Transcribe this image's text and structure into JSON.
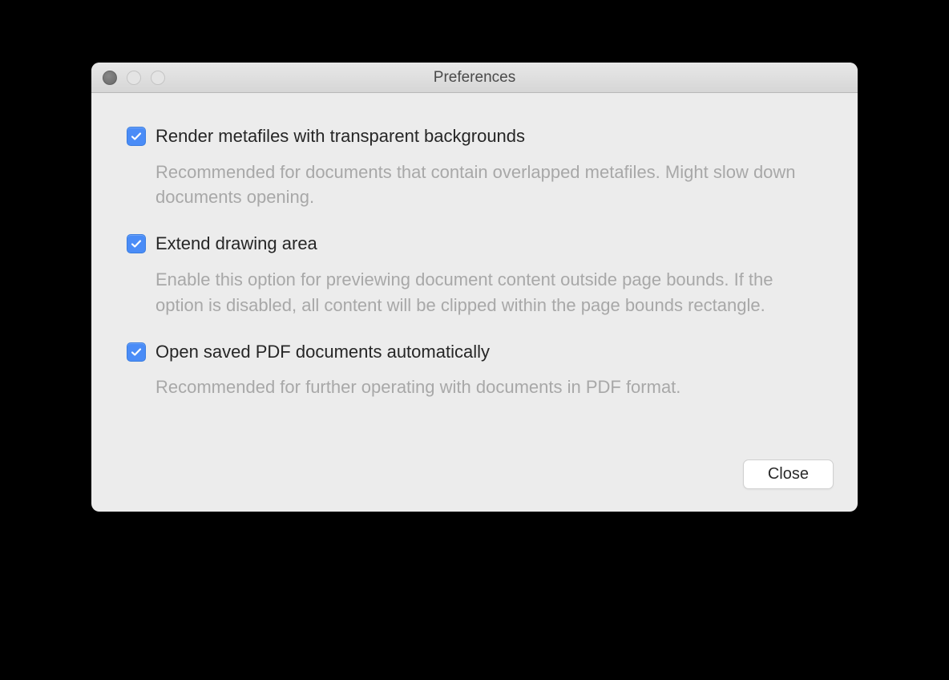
{
  "window": {
    "title": "Preferences"
  },
  "options": [
    {
      "label": "Render metafiles with transparent backgrounds",
      "description": "Recommended for documents that contain overlapped metafiles. Might slow down documents opening.",
      "checked": true
    },
    {
      "label": "Extend drawing area",
      "description": "Enable this option for previewing document content outside page bounds. If the option is disabled, all content will be clipped within the page bounds rectangle.",
      "checked": true
    },
    {
      "label": "Open saved PDF documents automatically",
      "description": "Recommended for further operating with documents in PDF format.",
      "checked": true
    }
  ],
  "buttons": {
    "close": "Close"
  }
}
